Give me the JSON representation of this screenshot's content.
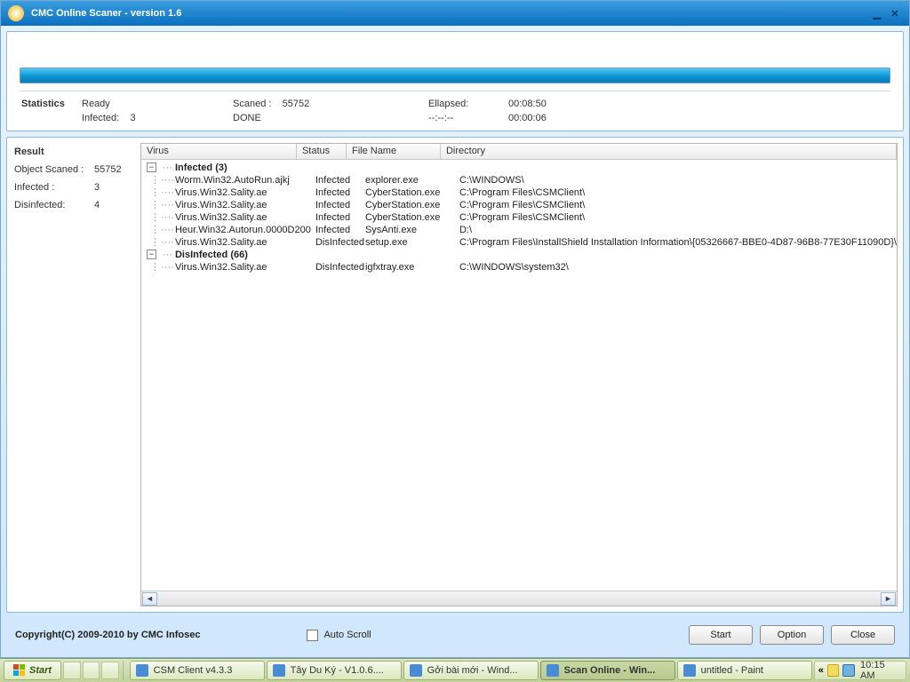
{
  "title": "CMC Online Scaner - version 1.6",
  "stats": {
    "header": "Statistics",
    "ready": "Ready",
    "scanned_label": "Scaned :",
    "scanned_value": "55752",
    "elapsed_label": "Ellapsed:",
    "elapsed_value": "00:08:50",
    "infected_label": "Infected:",
    "infected_value": "3",
    "done": "DONE",
    "dash": "--:--:--",
    "time2": "00:00:06"
  },
  "sidebar": {
    "header": "Result",
    "rows": [
      {
        "k": "Object Scaned :",
        "v": "55752"
      },
      {
        "k": "Infected :",
        "v": "3"
      },
      {
        "k": "Disinfected:",
        "v": "4"
      }
    ]
  },
  "columns": {
    "virus": "Virus",
    "status": "Status",
    "file": "File Name",
    "dir": "Directory"
  },
  "groups": [
    {
      "label": "Infected (3)",
      "rows": [
        {
          "virus": "Worm.Win32.AutoRun.ajkj",
          "status": "Infected",
          "file": "explorer.exe",
          "dir": "C:\\WINDOWS\\"
        },
        {
          "virus": "Virus.Win32.Sality.ae",
          "status": "Infected",
          "file": "CyberStation.exe",
          "dir": "C:\\Program Files\\CSMClient\\"
        },
        {
          "virus": "Virus.Win32.Sality.ae",
          "status": "Infected",
          "file": "CyberStation.exe",
          "dir": "C:\\Program Files\\CSMClient\\"
        },
        {
          "virus": "Virus.Win32.Sality.ae",
          "status": "Infected",
          "file": "CyberStation.exe",
          "dir": "C:\\Program Files\\CSMClient\\"
        },
        {
          "virus": "Heur.Win32.Autorun.0000D200",
          "status": "Infected",
          "file": "SysAnti.exe",
          "dir": "D:\\"
        },
        {
          "virus": "Virus.Win32.Sality.ae",
          "status": "DisInfected",
          "file": "setup.exe",
          "dir": "C:\\Program Files\\InstallShield Installation Information\\{05326667-BBE0-4D87-96B8-77E30F11090D}\\"
        }
      ]
    },
    {
      "label": "DisInfected (66)",
      "rows": [
        {
          "virus": "Virus.Win32.Sality.ae",
          "status": "DisInfected",
          "file": "igfxtray.exe",
          "dir": "C:\\WINDOWS\\system32\\"
        }
      ]
    }
  ],
  "footer": {
    "copyright": "Copyright(C) 2009-2010 by CMC Infosec",
    "autoscroll": "Auto Scroll",
    "buttons": {
      "start": "Start",
      "option": "Option",
      "close": "Close"
    }
  },
  "taskbar": {
    "start": "Start",
    "items": [
      {
        "label": "CSM Client v4.3.3",
        "active": false
      },
      {
        "label": "Tây Du Ký - V1.0.6....",
        "active": false
      },
      {
        "label": "Gởi bài mới - Wind...",
        "active": false
      },
      {
        "label": "Scan Online - Win...",
        "active": true
      },
      {
        "label": "untitled - Paint",
        "active": false
      }
    ],
    "tray_expand": "«",
    "clock": "10:15 AM"
  }
}
